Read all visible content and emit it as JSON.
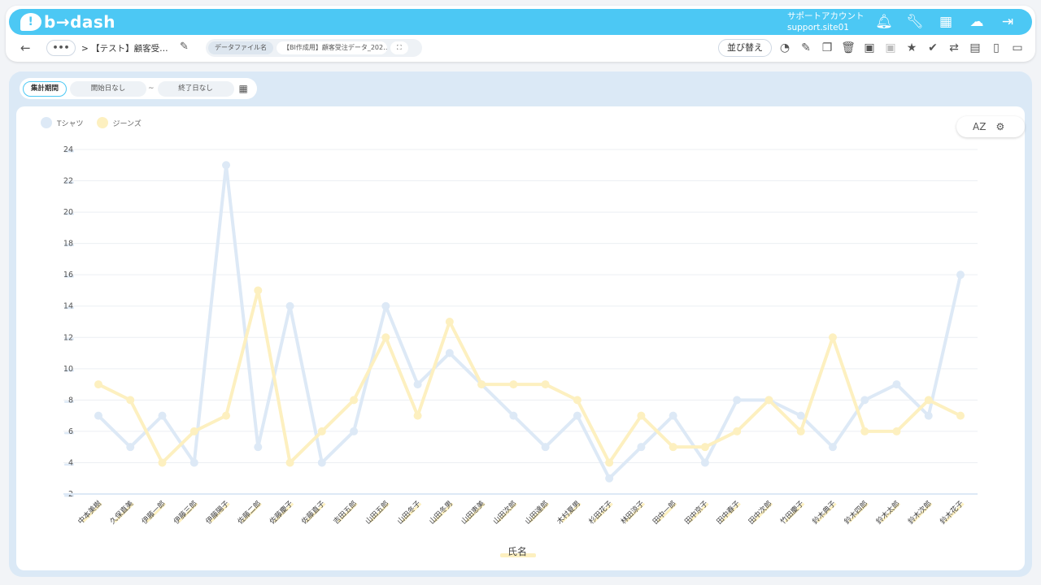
{
  "app": {
    "logo_text": "b→dash"
  },
  "account": {
    "line1": "サポートアカウント",
    "line2": "support.site01"
  },
  "top_icons": [
    "bell-icon",
    "wrench-icon",
    "grid-icon",
    "brain-icon",
    "logout-icon"
  ],
  "nav": {
    "back": "←",
    "more": "•••",
    "breadcrumb": "> 【テスト】顧客受…",
    "file_label": "データファイル名",
    "file_name": "【BI作成用】顧客受注データ_202…",
    "expand": "⛶",
    "sort_label": "並び替え"
  },
  "tool_icons": [
    "chart-type-icon",
    "edit-icon",
    "copy-icon",
    "delete-icon",
    "archive-icon",
    "unarchive-icon",
    "star-icon",
    "user-check-icon",
    "repeat-icon",
    "calendar-icon",
    "document-icon",
    "clipboard-icon"
  ],
  "period": {
    "label": "集計期間",
    "start": "開始日なし",
    "separator": "~",
    "end": "終了日なし"
  },
  "chart_tools": {
    "sort_az": "AZ",
    "settings": "⚙"
  },
  "colors": {
    "accent": "#4cc8f4",
    "series1": "#dde9f6",
    "series2": "#fdf0c0"
  },
  "chart_data": {
    "type": "line",
    "xlabel": "氏名",
    "ylabel": "",
    "ylim": [
      2,
      24
    ],
    "yticks": [
      2,
      4,
      6,
      8,
      10,
      12,
      14,
      16,
      18,
      20,
      22,
      24
    ],
    "grid": true,
    "legend_position": "top-left",
    "categories": [
      "中本美樹",
      "久保直美",
      "伊藤一郎",
      "伊藤三郎",
      "伊藤陽子",
      "佐藤二郎",
      "佐藤慶子",
      "佐藤直子",
      "吉田五郎",
      "山田五郎",
      "山田冬子",
      "山田冬男",
      "山田恵美",
      "山田次郎",
      "山田達郎",
      "木村夏男",
      "杉田花子",
      "林田涼子",
      "田中一郎",
      "田中京子",
      "田中春子",
      "田中次郎",
      "竹田慶子",
      "鈴木典子",
      "鈴木四郎",
      "鈴木太郎",
      "鈴木次郎",
      "鈴木花子"
    ],
    "series": [
      {
        "name": "Tシャツ",
        "values": [
          7,
          5,
          7,
          4,
          23,
          5,
          14,
          4,
          6,
          14,
          9,
          11,
          9,
          7,
          5,
          7,
          3,
          5,
          7,
          4,
          8,
          8,
          7,
          5,
          8,
          9,
          7,
          16
        ]
      },
      {
        "name": "ジーンズ",
        "values": [
          9,
          8,
          4,
          6,
          7,
          15,
          4,
          6,
          8,
          12,
          7,
          13,
          9,
          9,
          9,
          8,
          4,
          7,
          5,
          5,
          6,
          8,
          6,
          12,
          6,
          6,
          8,
          7
        ]
      }
    ]
  }
}
